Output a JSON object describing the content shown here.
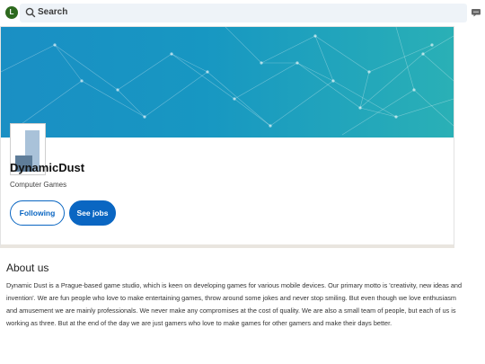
{
  "topbar": {
    "avatar_letter": "L",
    "search_label": "Search"
  },
  "company": {
    "name": "DynamicDust",
    "industry": "Computer Games",
    "buttons": {
      "following": "Following",
      "jobs": "See jobs"
    }
  },
  "about": {
    "heading": "About us",
    "text": "Dynamic Dust is a Prague-based game studio, which is keen on developing games for various mobile devices. Our primary motto is 'creativity, new ideas and invention'. We are fun people who love to make entertaining games, throw around some jokes and never stop smiling. But even though we love enthusiasm and amusement we are mainly professionals. We never make any compromises at the cost of quality. We are also a small team of people, but each of us is working as three. But at the end of the day we are just gamers who love to make games for other gamers and make their days better."
  },
  "colors": {
    "accent": "#0a66c2",
    "banner_start": "#1a8fc4",
    "banner_end": "#2ab0b6",
    "avatar_bg": "#2e6a1e"
  }
}
